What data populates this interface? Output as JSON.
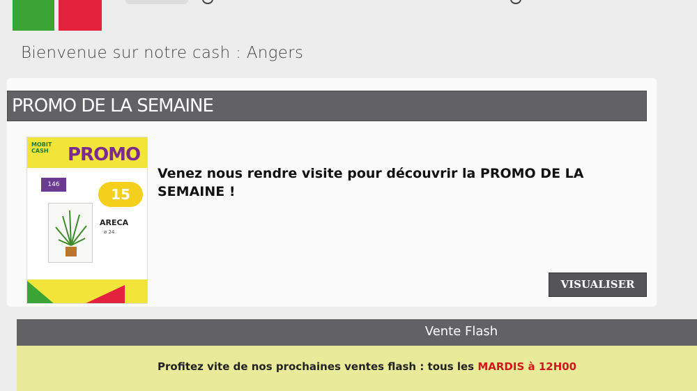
{
  "header": {
    "welcome": "Bienvenue sur notre cash : Angers",
    "logo_colors": [
      "#3aa535",
      "#e3233d"
    ]
  },
  "promo_section": {
    "title": "PROMO DE LA SEMAINE",
    "message": "Venez nous rendre visite pour découvrir la PROMO DE LA SEMAINE !",
    "button_label": "VISUALISER",
    "flyer": {
      "heading": "PROMO",
      "price": "15",
      "product": "ARECA",
      "badge": "146"
    }
  },
  "flash_section": {
    "title": "Vente Flash",
    "text_prefix": "Profitez vite de nos prochaines ventes flash : tous les ",
    "text_highlight": "MARDIS à 12H00"
  },
  "colors": {
    "header_bg": "#626266",
    "flash_body_bg": "#e9ea9a",
    "highlight": "#d2161e"
  }
}
